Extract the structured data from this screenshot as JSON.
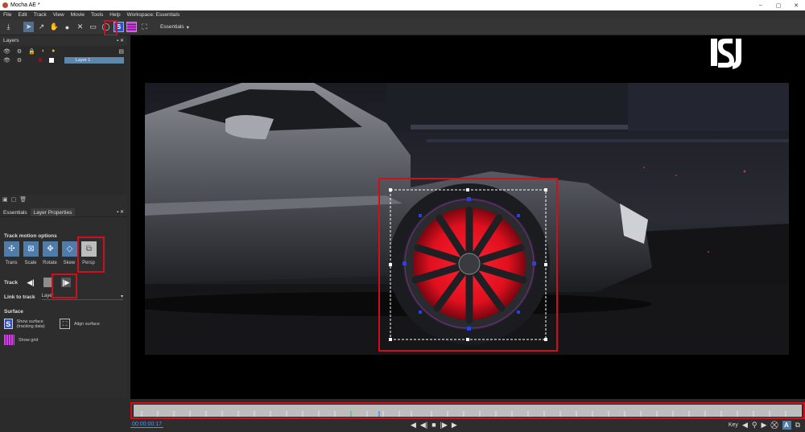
{
  "window": {
    "title": "Mocha AE *",
    "minimize": "–",
    "maximize": "▢",
    "close": "✕"
  },
  "menu": [
    "File",
    "Edit",
    "Track",
    "View",
    "Movie",
    "Tools",
    "Help"
  ],
  "toolbar": {
    "workspace_label": "Workspace: Essentials",
    "workspace_select": "Essentials",
    "icons": [
      "export-icon",
      "pick-icon",
      "add-point-icon",
      "hand-icon",
      "zoom-icon",
      "x-spline-icon",
      "rect-spline-icon",
      "circle-spline-icon",
      "show-surface-icon",
      "show-grid-icon",
      "align-surface-icon"
    ],
    "s_glyph": "S"
  },
  "layers_panel": {
    "title": "Layers",
    "layer_name": "Layer 1"
  },
  "tabs": [
    {
      "label": "Essentials"
    },
    {
      "label": "Layer Properties"
    }
  ],
  "track_motion": {
    "title": "Track motion options",
    "options": [
      "Trans",
      "Scale",
      "Rotate",
      "Skew",
      "Persp"
    ]
  },
  "track": {
    "label": "Track"
  },
  "link_to_track": {
    "label": "Link to track",
    "value": "Layer"
  },
  "surface": {
    "title": "Surface",
    "show_surface": "Show surface (tracking data)",
    "align_surface": "Align surface",
    "show_grid": "Show grid"
  },
  "timeline": {
    "timecode": "00:00:00:17",
    "key_label": "Key",
    "a_glyph": "A"
  },
  "colors": {
    "highlight_red": "#d10f1c",
    "accent_blue": "#4e7cab",
    "panel_bg": "#2d2d2d"
  }
}
